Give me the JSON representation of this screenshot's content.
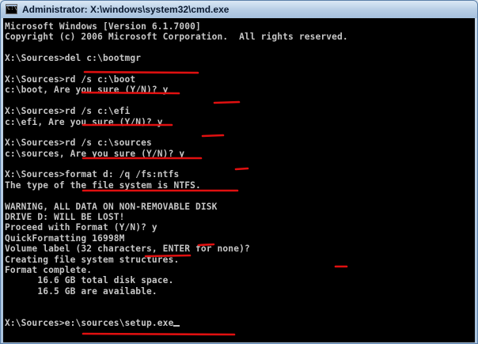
{
  "window": {
    "title": "Administrator: X:\\windows\\system32\\cmd.exe",
    "icon": "cmd-icon",
    "icon_text": "C:\\"
  },
  "console": {
    "lines": [
      "Microsoft Windows [Version 6.1.7000]",
      "Copyright (c) 2006 Microsoft Corporation.  All rights reserved.",
      "",
      "X:\\Sources>del c:\\bootmgr",
      "",
      "X:\\Sources>rd /s c:\\boot",
      "c:\\boot, Are you sure (Y/N)? y",
      "",
      "X:\\Sources>rd /s c:\\efi",
      "c:\\efi, Are you sure (Y/N)? y",
      "",
      "X:\\Sources>rd /s c:\\sources",
      "c:\\sources, Are you sure (Y/N)? y",
      "",
      "X:\\Sources>format d: /q /fs:ntfs",
      "The type of the file system is NTFS.",
      "",
      "WARNING, ALL DATA ON NON-REMOVABLE DISK",
      "DRIVE D: WILL BE LOST!",
      "Proceed with Format (Y/N)? y",
      "QuickFormatting 16998M",
      "Volume label (32 characters, ENTER for none)?",
      "Creating file system structures.",
      "Format complete.",
      "      16.6 GB total disk space.",
      "      16.5 GB are available.",
      "",
      "",
      "X:\\Sources>e:\\sources\\setup.exe"
    ],
    "text_color": "#c6c6c6",
    "background_color": "#000000",
    "annotation_color": "#e01010"
  }
}
